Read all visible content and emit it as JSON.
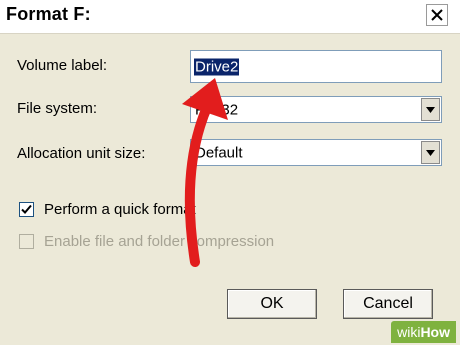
{
  "dialog": {
    "title": "Format F:",
    "close_label": "✕"
  },
  "fields": {
    "volume_label": {
      "label": "Volume label:",
      "value": "Drive2"
    },
    "file_system": {
      "label": "File system:",
      "value": "FAT32"
    },
    "allocation_unit_size": {
      "label": "Allocation unit size:",
      "value": "Default"
    }
  },
  "options": {
    "quick_format": {
      "label": "Perform a quick format",
      "checked": true
    },
    "compression": {
      "label": "Enable file and folder compression",
      "checked": false,
      "disabled": true
    }
  },
  "buttons": {
    "ok": "OK",
    "cancel": "Cancel"
  },
  "watermark": {
    "prefix": "wiki",
    "suffix": "How"
  },
  "colors": {
    "arrow": "#e21d1d",
    "selection": "#0a246a",
    "watermark": "#7fb23f"
  }
}
